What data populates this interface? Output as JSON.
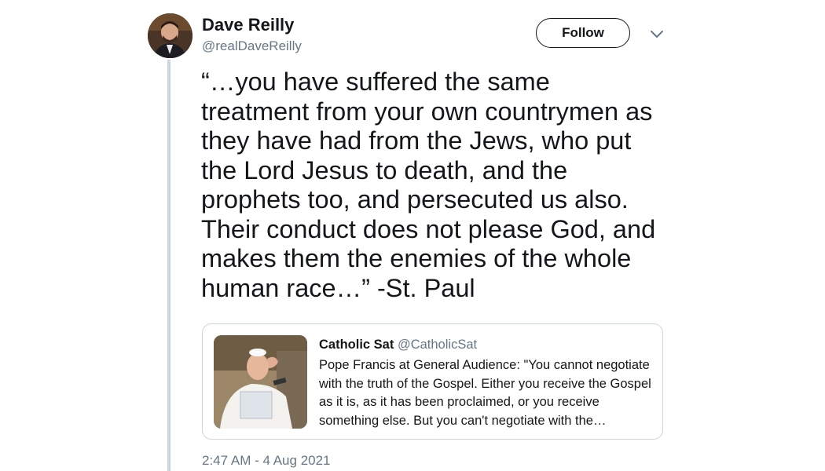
{
  "author": {
    "name": "Dave Reilly",
    "handle": "@realDaveReilly",
    "avatar_icon": "profile-photo"
  },
  "follow_label": "Follow",
  "menu_icon": "chevron-down-icon",
  "tweet_text": "“…you have suffered the same\ntreatment from your own countrymen as\nthey have had from the Jews, who put\nthe Lord Jesus to death, and the\nprophets too, and persecuted us also.\nTheir conduct does not please God, and\nmakes them the enemies of the whole\nhuman race…” -St. Paul",
  "quoted_tweet": {
    "name": "Catholic Sat",
    "handle": "@CatholicSat",
    "text": "Pope Francis at General Audience: \"You cannot negotiate with the truth of the Gospel. Either you receive the Gospel as it is, as it has been proclaimed, or you receive something else. But you can't negotiate with the…"
  },
  "timestamp": "2:47 AM - 4 Aug 2021",
  "colors": {
    "text_primary": "#14171a",
    "text_secondary": "#657786",
    "border": "#ccd6dd"
  }
}
